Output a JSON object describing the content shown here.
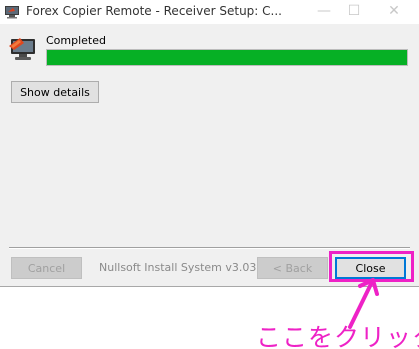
{
  "window": {
    "title": "Forex Copier Remote - Receiver Setup: C...",
    "icon": "app-installer-icon",
    "controls": {
      "minimize_icon": "minimize-icon",
      "maximize_icon": "maximize-icon",
      "close_icon": "close-icon",
      "minimize_glyph": "—",
      "maximize_glyph": "☐",
      "close_glyph": "✕"
    }
  },
  "install": {
    "icon": "installer-icon",
    "status": "Completed",
    "progress_percent": 100,
    "progress_color": "#06b025",
    "show_details_label": "Show details"
  },
  "footer": {
    "cancel_label": "Cancel",
    "branding": "Nullsoft Install System v3.03",
    "back_label": "< Back",
    "close_label": "Close"
  },
  "annotation": {
    "text": "ここをクリック",
    "color": "#ee22c6"
  }
}
